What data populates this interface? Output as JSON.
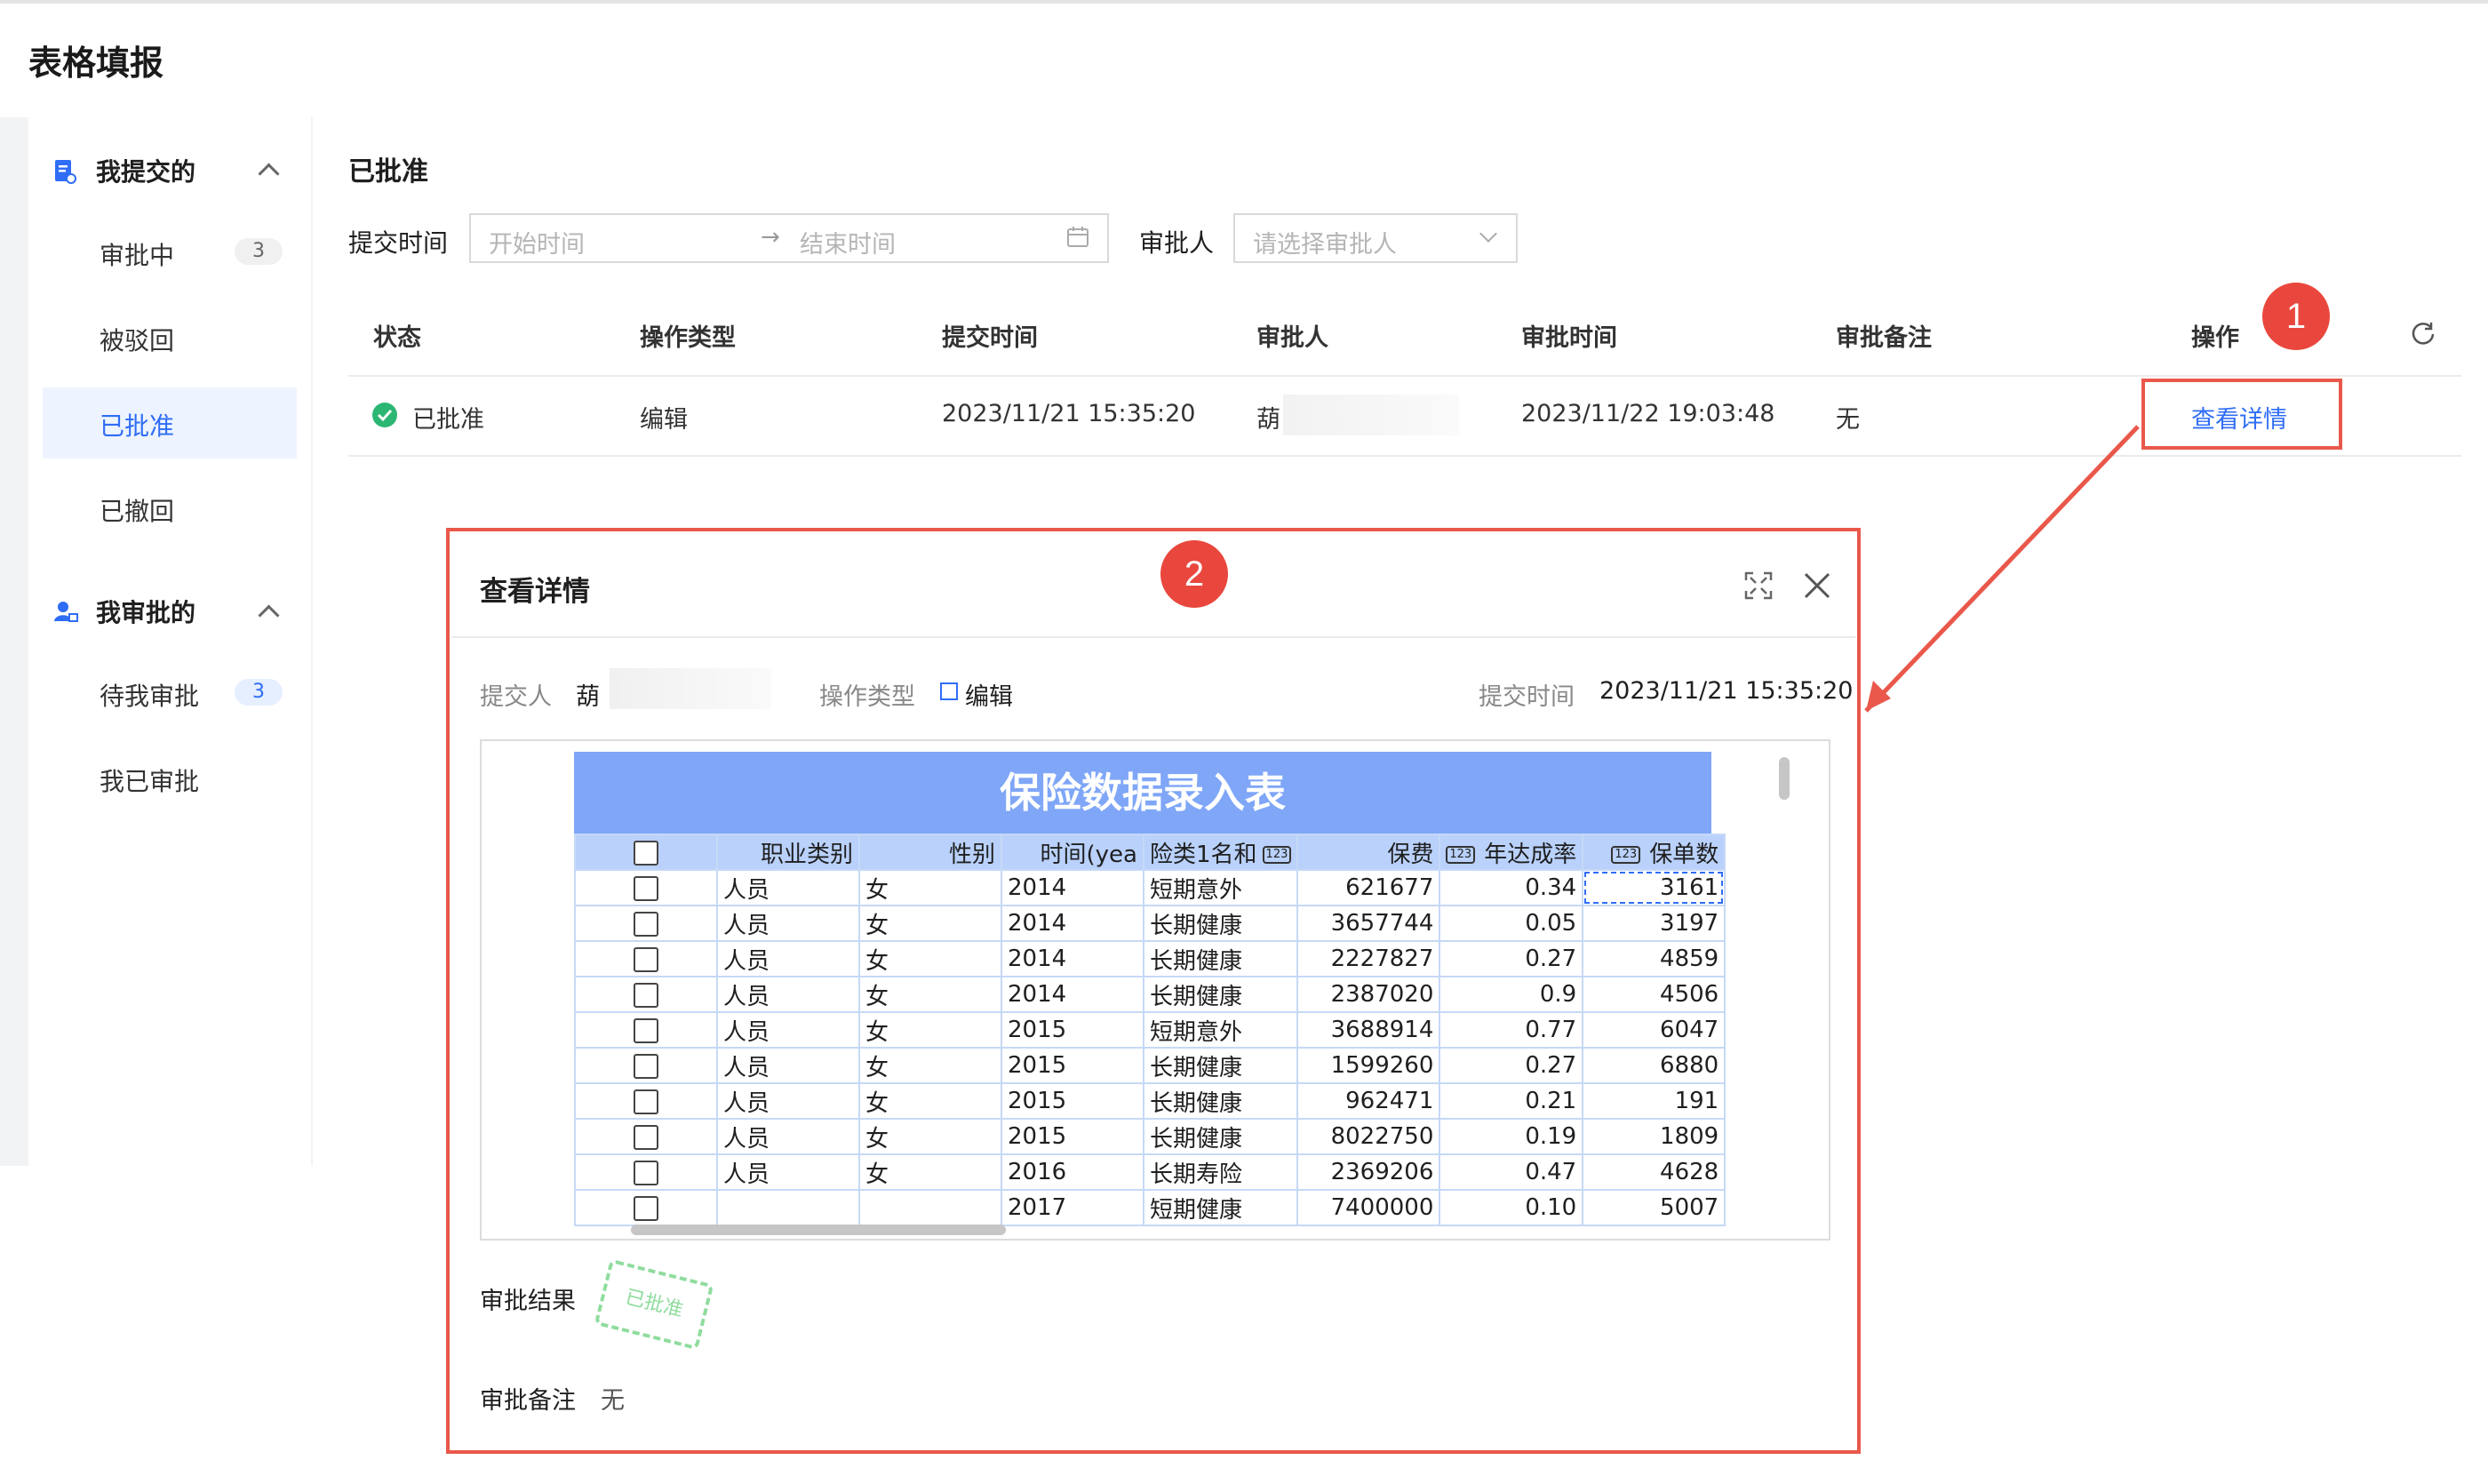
{
  "page_title": "表格填报",
  "sidebar": {
    "submitted_group": "我提交的",
    "submitted_items": [
      {
        "label": "审批中",
        "badge": "3"
      },
      {
        "label": "被驳回"
      },
      {
        "label": "已批准"
      },
      {
        "label": "已撤回"
      }
    ],
    "review_group": "我审批的",
    "review_items": [
      {
        "label": "待我审批",
        "badge": "3"
      },
      {
        "label": "我已审批"
      }
    ]
  },
  "main": {
    "section_title": "已批准",
    "filters": {
      "submit_time_label": "提交时间",
      "start_placeholder": "开始时间",
      "end_placeholder": "结束时间",
      "approver_label": "审批人",
      "approver_placeholder": "请选择审批人"
    },
    "table": {
      "columns": [
        "状态",
        "操作类型",
        "提交时间",
        "审批人",
        "审批时间",
        "审批备注",
        "操作"
      ],
      "row": {
        "status": "已批准",
        "op_type": "编辑",
        "submit_time": "2023/11/21 15:35:20",
        "approver": "葫",
        "approve_time": "2023/11/22 19:03:48",
        "remark": "无",
        "action": "查看详情"
      }
    },
    "annotations": {
      "marker1": "1",
      "marker2": "2"
    }
  },
  "dialog": {
    "title": "查看详情",
    "submitter_label": "提交人",
    "submitter_value": "葫",
    "op_type_label": "操作类型",
    "op_type_value": "编辑",
    "submit_time_label": "提交时间",
    "submit_time_value": "2023/11/21 15:35:20",
    "sheet": {
      "title": "保险数据录入表",
      "headers": [
        "",
        "职业类别",
        "性别",
        "时间(yea",
        "险类1名和",
        "保费",
        "年达成率",
        "保单数"
      ],
      "rows": [
        [
          "人员",
          "女",
          "2014",
          "短期意外",
          "621677",
          "0.34",
          "3161"
        ],
        [
          "人员",
          "女",
          "2014",
          "长期健康",
          "3657744",
          "0.05",
          "3197"
        ],
        [
          "人员",
          "女",
          "2014",
          "长期健康",
          "2227827",
          "0.27",
          "4859"
        ],
        [
          "人员",
          "女",
          "2014",
          "长期健康",
          "2387020",
          "0.9",
          "4506"
        ],
        [
          "人员",
          "女",
          "2015",
          "短期意外",
          "3688914",
          "0.77",
          "6047"
        ],
        [
          "人员",
          "女",
          "2015",
          "长期健康",
          "1599260",
          "0.27",
          "6880"
        ],
        [
          "人员",
          "女",
          "2015",
          "长期健康",
          "962471",
          "0.21",
          "191"
        ],
        [
          "人员",
          "女",
          "2015",
          "长期健康",
          "8022750",
          "0.19",
          "1809"
        ],
        [
          "人员",
          "女",
          "2016",
          "长期寿险",
          "2369206",
          "0.47",
          "4628"
        ],
        [
          "",
          "",
          "2017",
          "短期健康",
          "7400000",
          "0.10",
          "5007"
        ]
      ]
    },
    "result_label": "审批结果",
    "result_stamp": "已批准",
    "remark_label": "审批备注",
    "remark_value": "无"
  },
  "colors": {
    "accent": "#2f6df6",
    "annotation_red": "#e9584b",
    "sheet_title_bg": "#7fa6f7",
    "success": "#2bb673"
  }
}
